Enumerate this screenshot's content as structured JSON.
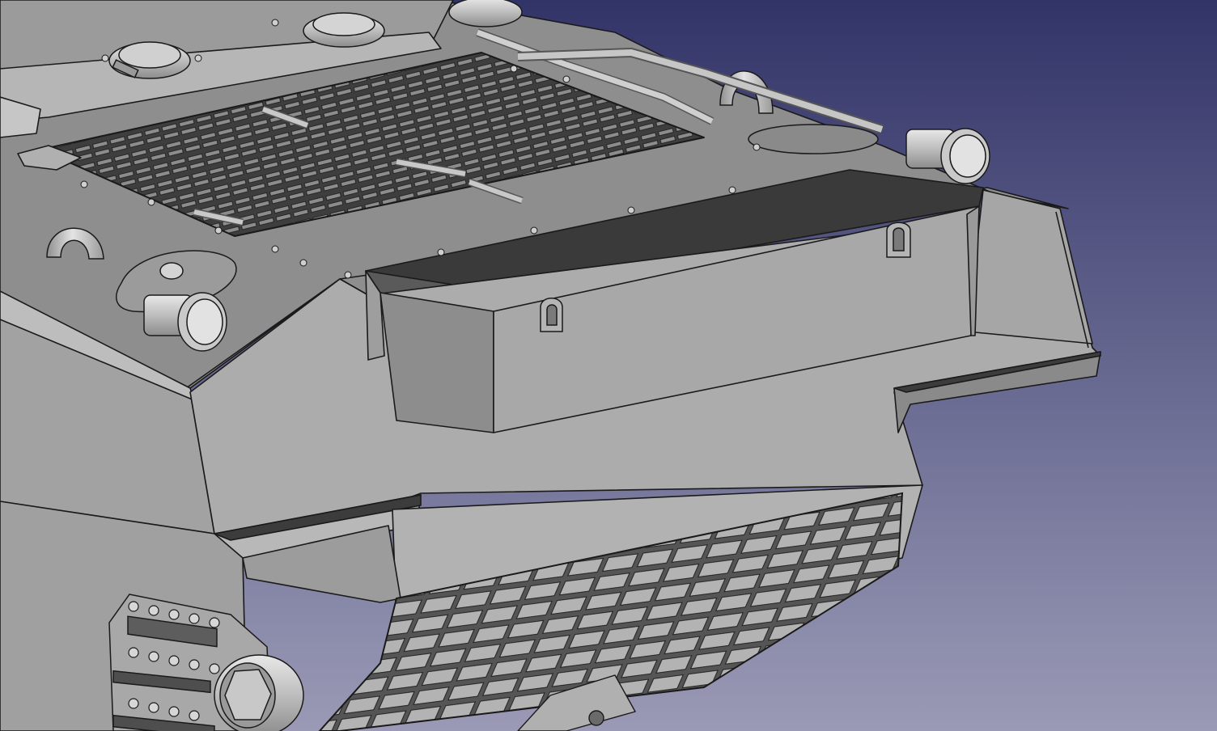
{
  "app": {
    "name": "3D CAD viewport",
    "background_top_color": "#323468",
    "background_bottom_color": "#9a9ab6",
    "model_face_color": "#a9a9a9",
    "model_edge_color": "#1a1a1a"
  },
  "viewport": {
    "model_subject": "",
    "icons": [
      "navigation-cube-hidden"
    ]
  }
}
